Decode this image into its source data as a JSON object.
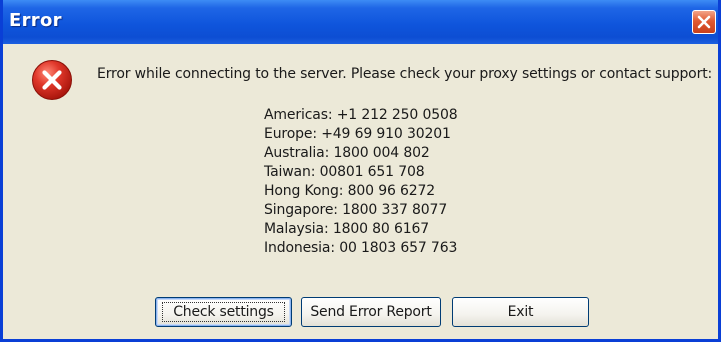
{
  "window": {
    "title": "Error",
    "close_icon": "close-icon"
  },
  "dialog": {
    "icon": "error-icon",
    "message": "Error while connecting to the server. Please check your proxy settings or contact support:",
    "contacts": [
      "Americas: +1 212 250 0508",
      "Europe: +49 69 910 30201",
      "Australia: 1800 004 802",
      "Taiwan: 00801 651 708",
      "Hong Kong: 800 96 6272",
      "Singapore: 1800 337 8077",
      "Malaysia: 1800 80 6167",
      "Indonesia: 00 1803 657 763"
    ]
  },
  "buttons": {
    "check_settings": "Check settings",
    "send_error_report": "Send Error Report",
    "exit": "Exit"
  },
  "colors": {
    "titlebar": "#0d4ed3",
    "window_bg": "#ece9d8",
    "error_red": "#d8281e",
    "close_button": "#e05a32"
  }
}
